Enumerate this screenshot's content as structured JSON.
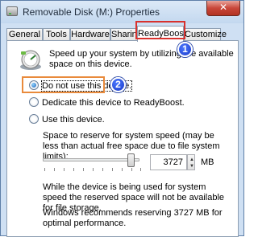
{
  "window": {
    "title": "Removable Disk (M:) Properties",
    "close_glyph": "✕"
  },
  "tabs": [
    {
      "label": "General"
    },
    {
      "label": "Tools"
    },
    {
      "label": "Hardware"
    },
    {
      "label": "Sharing"
    },
    {
      "label": "ReadyBoost",
      "selected": true
    },
    {
      "label": "Customize"
    }
  ],
  "readyboost": {
    "intro": "Speed up your system by utilizing the available space on this device.",
    "options": [
      {
        "label": "Do not use this device.",
        "selected": true
      },
      {
        "label": "Dedicate this device to ReadyBoost.",
        "selected": false
      },
      {
        "label": "Use this device.",
        "selected": false
      }
    ],
    "reserve_label": "Space to reserve for system speed (may be less than actual free space due to file system limits):",
    "reserve_value": "3727",
    "reserve_unit": "MB",
    "slider_fraction": 0.9,
    "note_in_use": "While the device is being used for system speed the reserved space will not be available for file storage.",
    "note_recommend": "Windows recommends reserving 3727 MB for optimal performance."
  },
  "annotations": {
    "marker_1": "1",
    "marker_2": "2",
    "highlight_tab_color": "#d9312d",
    "highlight_option_color": "#e98a3b",
    "marker_color": "#1838c9"
  },
  "icons": {
    "app": "removable-disk-icon",
    "readyboost": "readyboost-gauge-icon"
  }
}
